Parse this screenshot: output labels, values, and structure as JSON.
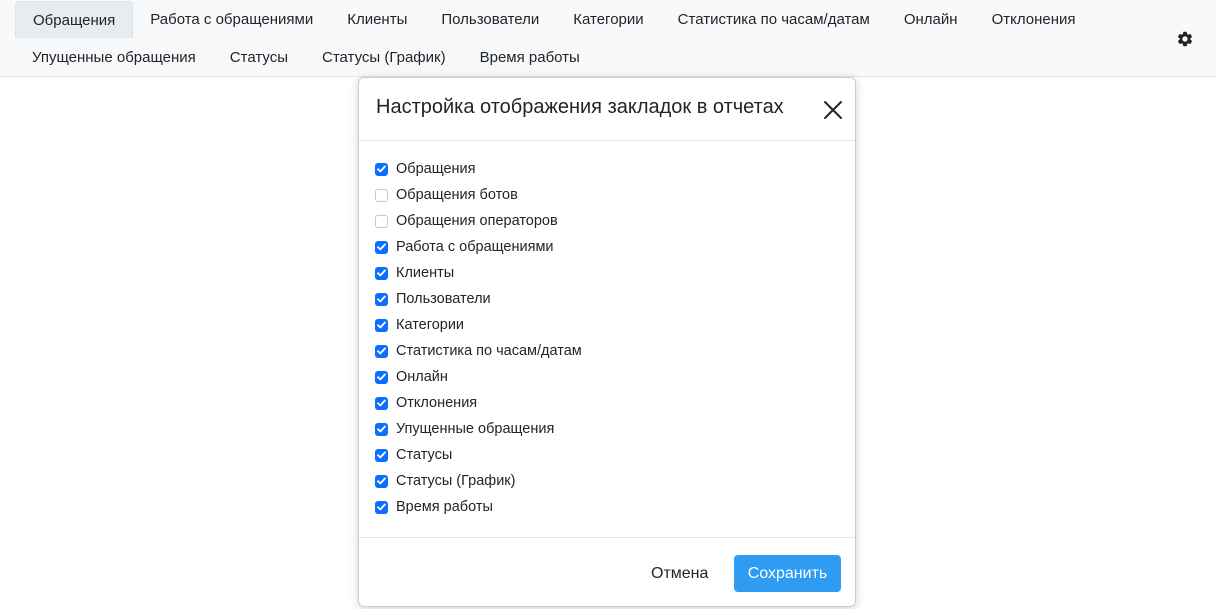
{
  "nav": {
    "row1": [
      "Обращения",
      "Работа с обращениями",
      "Клиенты",
      "Пользователи",
      "Категории",
      "Статистика по часам/датам",
      "Онлайн",
      "Отклонения"
    ],
    "row2": [
      "Упущенные обращения",
      "Статусы",
      "Статусы (График)",
      "Время работы"
    ],
    "active_tab": "Обращения",
    "settings_icon": "gear-icon"
  },
  "modal": {
    "title": "Настройка отображения закладок в отчетах",
    "close_icon": "close-icon",
    "options": [
      {
        "label": "Обращения",
        "checked": true
      },
      {
        "label": "Обращения ботов",
        "checked": false
      },
      {
        "label": "Обращения операторов",
        "checked": false
      },
      {
        "label": "Работа с обращениями",
        "checked": true
      },
      {
        "label": "Клиенты",
        "checked": true
      },
      {
        "label": "Пользователи",
        "checked": true
      },
      {
        "label": "Категории",
        "checked": true
      },
      {
        "label": "Статистика по часам/датам",
        "checked": true
      },
      {
        "label": "Онлайн",
        "checked": true
      },
      {
        "label": "Отклонения",
        "checked": true
      },
      {
        "label": "Упущенные обращения",
        "checked": true
      },
      {
        "label": "Статусы",
        "checked": true
      },
      {
        "label": "Статусы (График)",
        "checked": true
      },
      {
        "label": "Время работы",
        "checked": true
      }
    ],
    "cancel_label": "Отмена",
    "save_label": "Сохранить"
  },
  "colors": {
    "accent": "#0d6efd",
    "save_button": "#2d9cf2",
    "topbar_bg": "#f8f9fa"
  }
}
